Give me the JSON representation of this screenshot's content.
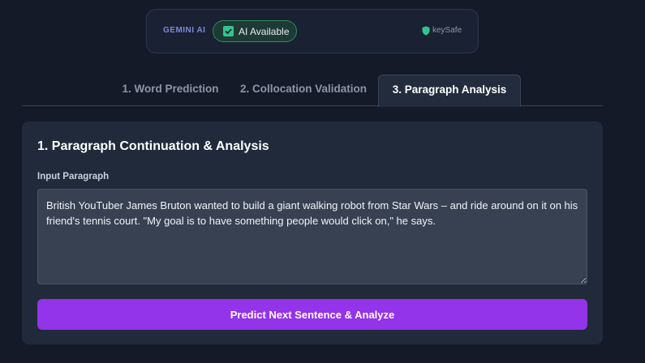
{
  "status": {
    "provider_label": "GEMINI AI",
    "ai_status": "AI Available",
    "security_label": "keySafe"
  },
  "tabs": [
    {
      "label": "1. Word Prediction",
      "active": false
    },
    {
      "label": "2. Collocation Validation",
      "active": false
    },
    {
      "label": "3. Paragraph Analysis",
      "active": true
    }
  ],
  "card": {
    "title": "1. Paragraph Continuation & Analysis",
    "input_label": "Input Paragraph",
    "input_value": "British YouTuber James Bruton wanted to build a giant walking robot from Star Wars – and ride around on it on his friend's tennis court. \"My goal is to have something people would click on,\" he says.",
    "submit_label": "Predict Next Sentence & Analyze"
  },
  "colors": {
    "background": "#141a27",
    "accent": "#9333ea",
    "success": "#34c38f"
  },
  "icons": [
    "check-icon",
    "shield-icon"
  ]
}
